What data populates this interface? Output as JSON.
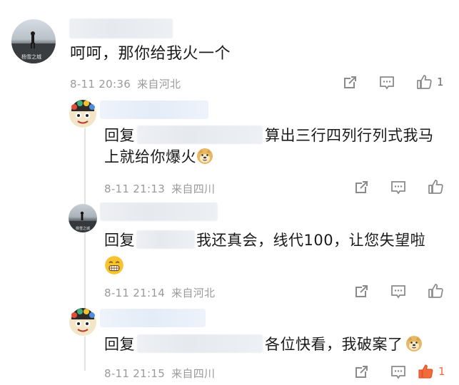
{
  "top": {
    "comment": "呵呵，那你给我火一个",
    "time": "8-11 20:36",
    "source": "来自河北",
    "like_count": "1",
    "avatar_caption": "杨雪之城"
  },
  "replies": [
    {
      "prefix": "回复",
      "text_after": "算出三行四列行列式我马",
      "text_line2": "上就给你爆火",
      "time": "8-11 21:13",
      "source": "来自四川",
      "like_count": ""
    },
    {
      "prefix": "回复",
      "text_after": "我还真会，线代100，让您失望啦",
      "time": "8-11 21:14",
      "source": "来自河北",
      "like_count": "",
      "avatar_caption": "杨雪之城"
    },
    {
      "prefix": "回复",
      "text_after": "各位快看，我破案了",
      "time": "8-11 21:15",
      "source": "来自四川",
      "like_count": "1"
    }
  ],
  "colors": {
    "meta": "#9a9a9a",
    "liked": "#f26b3a",
    "icon": "#8a8a8a"
  }
}
